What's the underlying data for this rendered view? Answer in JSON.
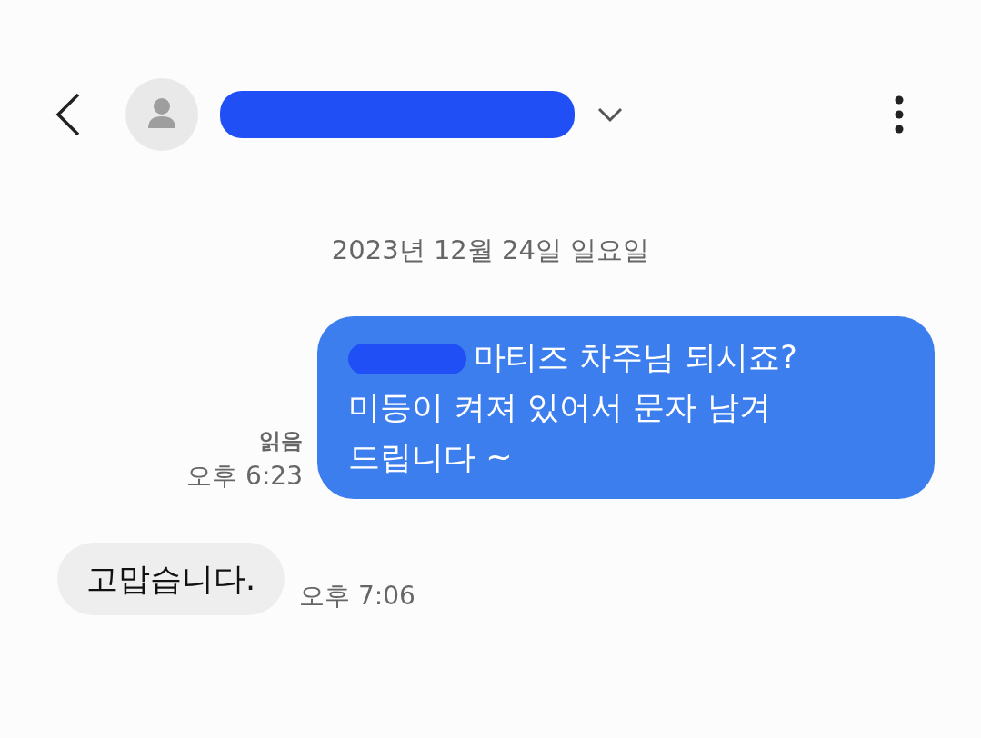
{
  "header": {
    "name_redacted": true
  },
  "date_divider": "2023년 12월 24일 일요일",
  "messages": [
    {
      "kind": "sent",
      "redacted_prefix": true,
      "lines": [
        "마티즈 차주님 되시죠?",
        "미등이 켜져 있어서 문자 남겨",
        "드립니다 ~"
      ],
      "status": "읽음",
      "time": "오후 6:23"
    },
    {
      "kind": "received",
      "lines": [
        "고맙습니다."
      ],
      "time": "오후 7:06"
    }
  ]
}
